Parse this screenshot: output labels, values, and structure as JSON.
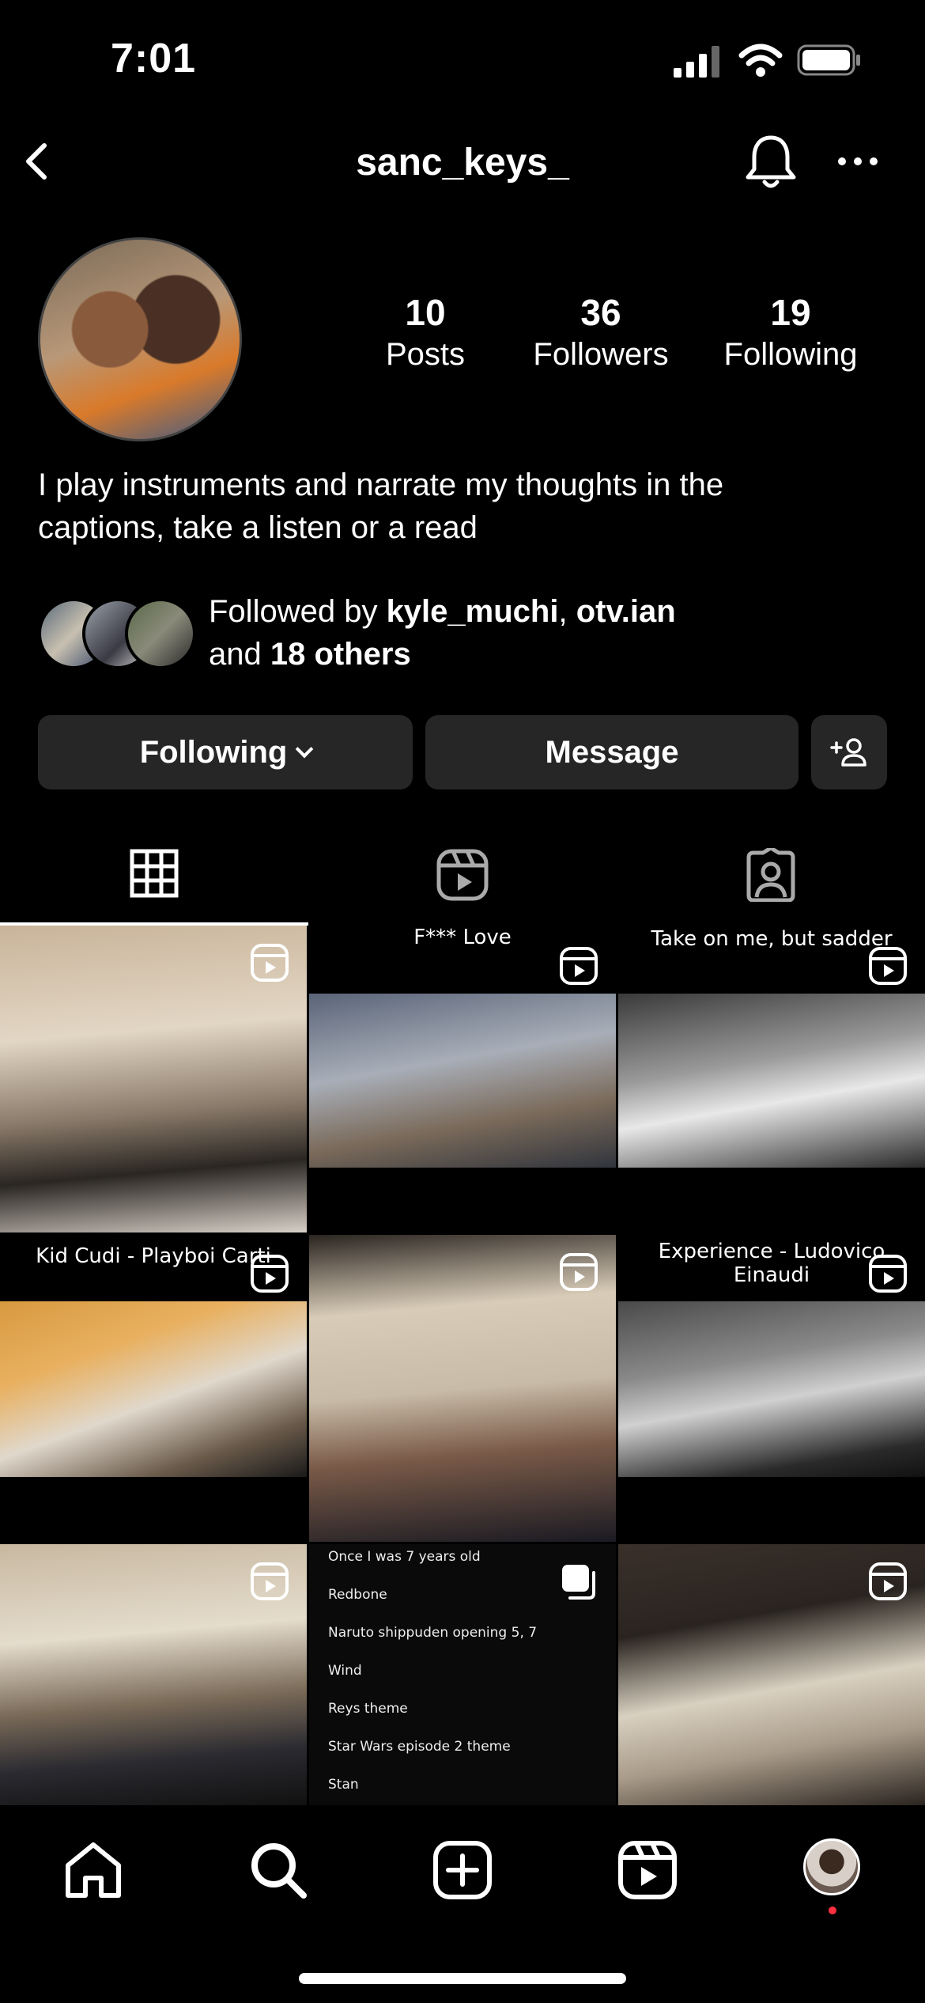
{
  "status_bar": {
    "time": "7:01"
  },
  "header": {
    "username": "sanc_keys_"
  },
  "profile": {
    "stats": [
      {
        "value": "10",
        "label": "Posts"
      },
      {
        "value": "36",
        "label": "Followers"
      },
      {
        "value": "19",
        "label": "Following"
      }
    ],
    "bio_line1": "I play instruments and narrate my thoughts in the",
    "bio_line2": "captions, take a listen or a read",
    "followed_by": {
      "prefix": "Followed by ",
      "user1": "kyle_muchi",
      "sep": ", ",
      "user2": "otv.ian",
      "and": "and ",
      "others": "18 others"
    }
  },
  "actions": {
    "following_label": "Following",
    "message_label": "Message"
  },
  "grid": {
    "captions": {
      "post2": "F*** Love",
      "post3": "Take on me, but sadder",
      "post4": "Kid Cudi - Playboi Carti",
      "post6": "Experience - Ludovico Einaudi"
    },
    "list_post": [
      "Once I was 7 years old",
      "Redbone",
      "Naruto shippuden opening 5, 7",
      "Wind",
      "Reys theme",
      "Star Wars episode 2 theme",
      "Stan"
    ]
  },
  "colors": {
    "button_bg": "#262626",
    "notification_dot": "#ff3040"
  }
}
